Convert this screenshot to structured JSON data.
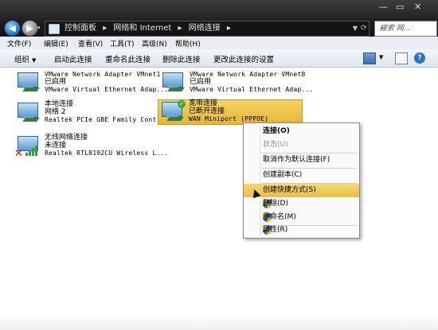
{
  "address": {
    "crumbs": [
      "控制面板",
      "▸",
      "网络和 Internet",
      "▸",
      "网络连接",
      "▸"
    ],
    "search_placeholder": "搜索 网..."
  },
  "menu": [
    "文件(F)",
    "编辑(E)",
    "查看(V)",
    "工具(T)",
    "高级(N)",
    "帮助(H)"
  ],
  "toolbar": {
    "organize": "组织",
    "buttons": [
      "启动此连接",
      "重命名此连接",
      "删除此连接",
      "更改此连接的设置"
    ]
  },
  "connections": [
    {
      "name": "VMware Network Adapter VMnet1",
      "status": "已启用",
      "device": "VMware Virtual Ethernet Adap..."
    },
    {
      "name": "VMware Network Adapter VMnet8",
      "status": "已启用",
      "device": "VMware Virtual Ethernet Adap..."
    },
    {
      "name": "本地连接",
      "status": "网络  2",
      "device": "Realtek PCIe GBE Family Cont..."
    },
    {
      "name": "宽带连接",
      "status": "已断开连接",
      "device": "WAN Miniport (PPPOE)"
    },
    {
      "name": "无线网络连接",
      "status": "未连接",
      "device": "Realtek RTL8192CU Wireless L..."
    }
  ],
  "context_menu": {
    "items": [
      {
        "label": "连接(O)",
        "style": "bold"
      },
      {
        "label": "状态(U)",
        "style": "disabled"
      },
      {
        "label": "取消作为默认连接(F)",
        "style": "normal"
      },
      {
        "label": "创建副本(C)",
        "style": "normal"
      },
      {
        "label": "创建快捷方式(S)",
        "style": "highlighted"
      },
      {
        "label": "删除(D)",
        "style": "normal"
      },
      {
        "label": "重命名(M)",
        "style": "normal"
      },
      {
        "label": "属性(R)",
        "style": "normal"
      }
    ]
  }
}
